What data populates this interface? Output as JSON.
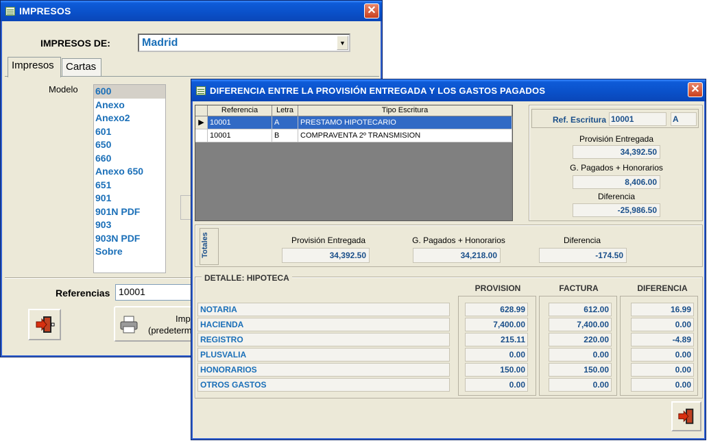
{
  "impresos": {
    "title": "IMPRESOS",
    "impresos_de_label": "IMPRESOS DE:",
    "impresos_de_value": "Madrid",
    "tabs": [
      "Impresos",
      "Cartas"
    ],
    "modelo_label": "Modelo",
    "modelos": [
      "600",
      "Anexo",
      "Anexo2",
      "601",
      "650",
      "660",
      "Anexo 650",
      "651",
      "901",
      "901N PDF",
      "903",
      "903N PDF",
      "Sobre"
    ],
    "selected_modelo": "600",
    "referencias_label": "Referencias",
    "referencias_value": "10001",
    "print_line1": "Imp",
    "print_line2": "(predeterm",
    "close_glyph": "✕"
  },
  "diferencia": {
    "title": "DIFERENCIA ENTRE LA PROVISIÓN ENTREGADA Y LOS GASTOS PAGADOS",
    "close_glyph": "✕",
    "grid": {
      "columns": [
        "Referencia",
        "Letra",
        "Tipo Escritura"
      ],
      "rows": [
        {
          "ref": "10001",
          "letra": "A",
          "tipo": "PRESTAMO HIPOTECARIO",
          "selected": true
        },
        {
          "ref": "10001",
          "letra": "B",
          "tipo": "COMPRAVENTA 2º TRANSMISION",
          "selected": false
        }
      ],
      "indicator": "▶"
    },
    "ref_escritura": {
      "label": "Ref. Escritura",
      "value": "10001",
      "letra": "A"
    },
    "provision_entregada": {
      "label": "Provisión Entregada",
      "value": "34,392.50"
    },
    "gastos_pagados": {
      "label": "G. Pagados + Honorarios",
      "value": "8,406.00"
    },
    "diferencia": {
      "label": "Diferencia",
      "value": "-25,986.50"
    },
    "totales": {
      "side_label": "Totales",
      "provision_label": "Provisión Entregada",
      "provision_value": "34,392.50",
      "gastos_label": "G. Pagados + Honorarios",
      "gastos_value": "34,218.00",
      "diferencia_label": "Diferencia",
      "diferencia_value": "-174.50"
    },
    "detalle": {
      "title": "DETALLE:  HIPOTECA",
      "col_provision": "PROVISION",
      "col_factura": "FACTURA",
      "col_diferencia": "DIFERENCIA",
      "rows": [
        {
          "concepto": "NOTARIA",
          "provision": "628.99",
          "factura": "612.00",
          "diferencia": "16.99"
        },
        {
          "concepto": "HACIENDA",
          "provision": "7,400.00",
          "factura": "7,400.00",
          "diferencia": "0.00"
        },
        {
          "concepto": "REGISTRO",
          "provision": "215.11",
          "factura": "220.00",
          "diferencia": "-4.89"
        },
        {
          "concepto": "PLUSVALIA",
          "provision": "0.00",
          "factura": "0.00",
          "diferencia": "0.00"
        },
        {
          "concepto": "HONORARIOS",
          "provision": "150.00",
          "factura": "150.00",
          "diferencia": "0.00"
        },
        {
          "concepto": "OTROS GASTOS",
          "provision": "0.00",
          "factura": "0.00",
          "diferencia": "0.00"
        }
      ]
    }
  }
}
